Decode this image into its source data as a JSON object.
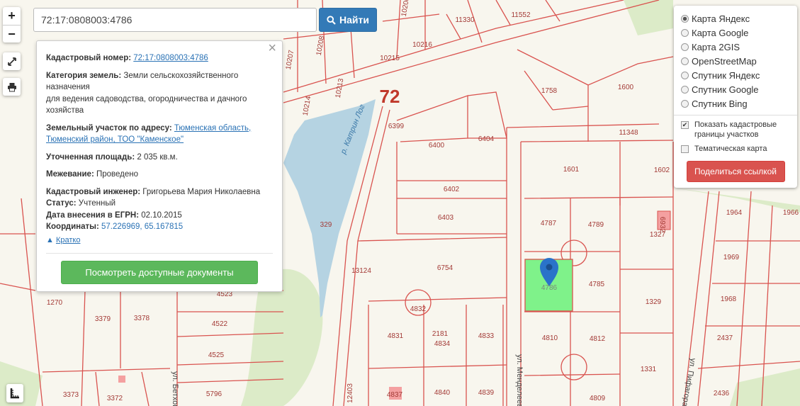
{
  "search": {
    "value": "72:17:0808003:4786",
    "button_label": "Найти"
  },
  "zoom": {
    "in_label": "+",
    "out_label": "−"
  },
  "popup": {
    "cadastral_label": "Кадастровый номер:",
    "cadastral_value": "72:17:0808003:4786",
    "category_label": "Категория земель:",
    "category_value": "Земли сельскохозяйственного назначения",
    "category_use": "для ведения садоводства, огородничества и дачного хозяйства",
    "address_label": "Земельный участок по адресу:",
    "address_value": "Тюменская область, Тюменский район, ТОО \"Каменское\"",
    "area_label": "Уточненная площадь:",
    "area_value": "2 035 кв.м.",
    "survey_label": "Межевание:",
    "survey_value": "Проведено",
    "engineer_label": "Кадастровый инженер:",
    "engineer_value": "Григорьева Мария Николаевна",
    "status_label": "Статус:",
    "status_value": "Учтенный",
    "egrn_label": "Дата внесения в ЕГРН:",
    "egrn_value": "02.10.2015",
    "coords_label": "Координаты:",
    "coords_value": "57.226969, 65.167815",
    "brief_label": "Кратко",
    "docs_button": "Посмотреть доступные документы"
  },
  "layers": {
    "options": [
      "Карта Яндекс",
      "Карта Google",
      "Карта 2GIS",
      "OpenStreetMap",
      "Спутник Яндекс",
      "Спутник Google",
      "Спутник Bing"
    ],
    "selected": "Карта Яндекс",
    "show_borders": "Показать кадастровые границы участков",
    "thematic": "Тематическая карта",
    "share_button": "Поделиться ссылкой"
  },
  "map": {
    "region_number": "72",
    "river_label": "р. Катрин Лог",
    "streets": [
      "ул. Менделеева",
      "ул. Бетховена",
      "ул. Пифагора"
    ],
    "parcels": [
      "4786",
      "4787",
      "4789",
      "4785",
      "4810",
      "4812",
      "4809",
      "4832",
      "4831",
      "2181",
      "4834",
      "4833",
      "4840",
      "4839",
      "4837",
      "1601",
      "1602",
      "1327",
      "1329",
      "1331",
      "6754",
      "6403",
      "6402",
      "6400",
      "6404",
      "6399",
      "13124",
      "329",
      "1758",
      "1600",
      "11348",
      "11330",
      "11552",
      "1964",
      "1966",
      "1969",
      "1968",
      "2437",
      "2436",
      "1270",
      "3379",
      "3378",
      "4523",
      "4522",
      "4525",
      "5796",
      "3373",
      "3372",
      "12403",
      "10208",
      "10207",
      "10213",
      "10214",
      "10215",
      "10216",
      "10206",
      "6932"
    ],
    "selected_parcel": "4786"
  },
  "colors": {
    "parcel_line": "#d9534f",
    "selected_fill": "#7ff28a",
    "water": "#b5d3e2",
    "green": "#dcebc8",
    "accent_blue": "#337ab7"
  }
}
